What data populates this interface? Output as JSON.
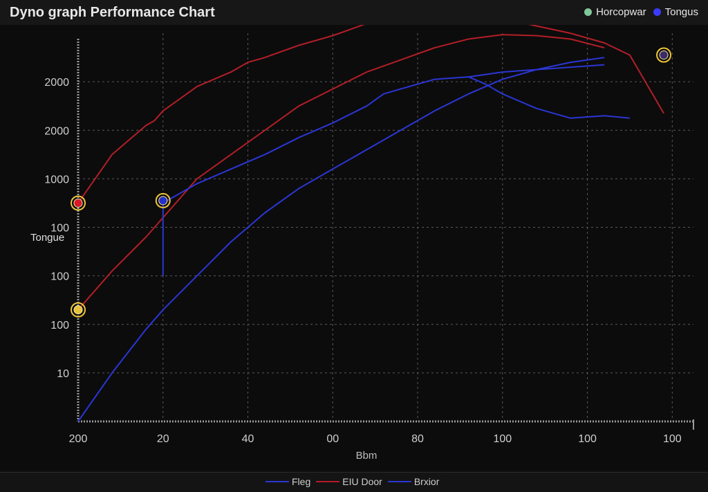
{
  "header": {
    "title": "Dyno graph Performance Chart",
    "legend": [
      {
        "label": "Horcopwar",
        "color": "#7fc79a"
      },
      {
        "label": "Tongus",
        "color": "#3b3bff"
      }
    ]
  },
  "footer": {
    "legend": [
      {
        "label": "Fleg",
        "color": "#2b36d6"
      },
      {
        "label": "EIU Door",
        "color": "#b31b2a"
      },
      {
        "label": "Brxior",
        "color": "#2b36d6"
      }
    ]
  },
  "chart_data": {
    "type": "line",
    "title": "Dyno graph Performance Chart",
    "xlabel": "Bbm",
    "ylabel": "Tongue",
    "x_ticks": [
      "200",
      "20",
      "40",
      "00",
      "80",
      "100",
      "100",
      "100"
    ],
    "y_ticks": [
      "10",
      "100",
      "100",
      "100",
      "1000",
      "2000",
      "2000"
    ],
    "xlim": [
      0,
      7.25
    ],
    "ylim": [
      -1,
      7
    ],
    "grid": true,
    "legend_position": "top-right",
    "series": [
      {
        "color": "#b41e28",
        "x": [
          0,
          0.4,
          0.8,
          0.9,
          1.0,
          1.4,
          1.8,
          2.0,
          2.2,
          2.6,
          3.0,
          3.4,
          3.6,
          3.8,
          4.2,
          4.4,
          4.6,
          5.0,
          5.4,
          5.8,
          6.2,
          6.5,
          6.9
        ],
        "y": [
          3.5,
          4.5,
          5.1,
          5.2,
          5.4,
          5.9,
          6.2,
          6.4,
          6.5,
          6.75,
          6.95,
          7.2,
          7.4,
          7.45,
          7.5,
          7.45,
          7.4,
          7.3,
          7.15,
          7.0,
          6.8,
          6.55,
          5.35
        ]
      },
      {
        "color": "#b41e28",
        "x": [
          0,
          0.4,
          0.8,
          1.0,
          1.4,
          1.8,
          2.2,
          2.6,
          3.0,
          3.4,
          3.8,
          4.2,
          4.6,
          5.0,
          5.4,
          5.8,
          6.2
        ],
        "y": [
          1.3,
          2.1,
          2.8,
          3.2,
          4.0,
          4.5,
          5.0,
          5.5,
          5.85,
          6.2,
          6.45,
          6.7,
          6.88,
          6.97,
          6.95,
          6.88,
          6.7
        ]
      },
      {
        "color": "#2b36d6",
        "x": [
          1.0,
          1.0,
          1.1,
          1.4,
          1.8,
          2.2,
          2.6,
          3.0,
          3.4,
          3.6,
          3.8,
          4.2,
          4.6,
          5.0,
          5.4,
          5.8,
          6.2
        ],
        "y": [
          2.0,
          3.5,
          3.6,
          3.9,
          4.2,
          4.5,
          4.85,
          5.15,
          5.5,
          5.75,
          5.85,
          6.05,
          6.1,
          6.2,
          6.25,
          6.3,
          6.35
        ]
      },
      {
        "color": "#2b36d6",
        "x": [
          4.6,
          4.8,
          5.0,
          5.4,
          5.8,
          6.2,
          6.5
        ],
        "y": [
          6.1,
          5.95,
          5.75,
          5.45,
          5.25,
          5.3,
          5.25
        ]
      },
      {
        "color": "#2b36d6",
        "x": [
          0,
          0.4,
          0.8,
          1.0,
          1.4,
          1.8,
          2.2,
          2.6,
          3.0,
          3.4,
          3.8,
          4.2,
          4.6,
          5.0,
          5.4,
          5.8,
          6.2
        ],
        "y": [
          -1.0,
          0.0,
          0.9,
          1.3,
          2.0,
          2.7,
          3.3,
          3.8,
          4.2,
          4.6,
          5.0,
          5.4,
          5.75,
          6.05,
          6.25,
          6.4,
          6.5
        ]
      }
    ],
    "markers": [
      {
        "x": 0,
        "y": 3.5,
        "fill": "#d8182a"
      },
      {
        "x": 0,
        "y": 1.3,
        "fill": "#e6c23a"
      },
      {
        "x": 1.0,
        "y": 3.55,
        "fill": "#2430c8"
      },
      {
        "x": 6.9,
        "y": 6.55,
        "fill": "#3a2a6a"
      }
    ]
  }
}
